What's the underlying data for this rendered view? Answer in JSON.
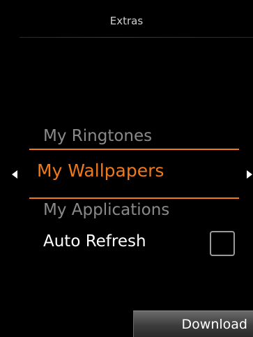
{
  "header": {
    "title": "Extras"
  },
  "menu": {
    "previous_item": "My Ringtones",
    "selected_item": "My Wallpapers",
    "next_item": "My Applications"
  },
  "options": {
    "auto_refresh_label": "Auto Refresh",
    "auto_refresh_checked": false
  },
  "softkeys": {
    "right_label": "Download"
  },
  "colors": {
    "accent": "#f07a1a",
    "background": "#000000",
    "dim_text": "#8a8a8a"
  }
}
